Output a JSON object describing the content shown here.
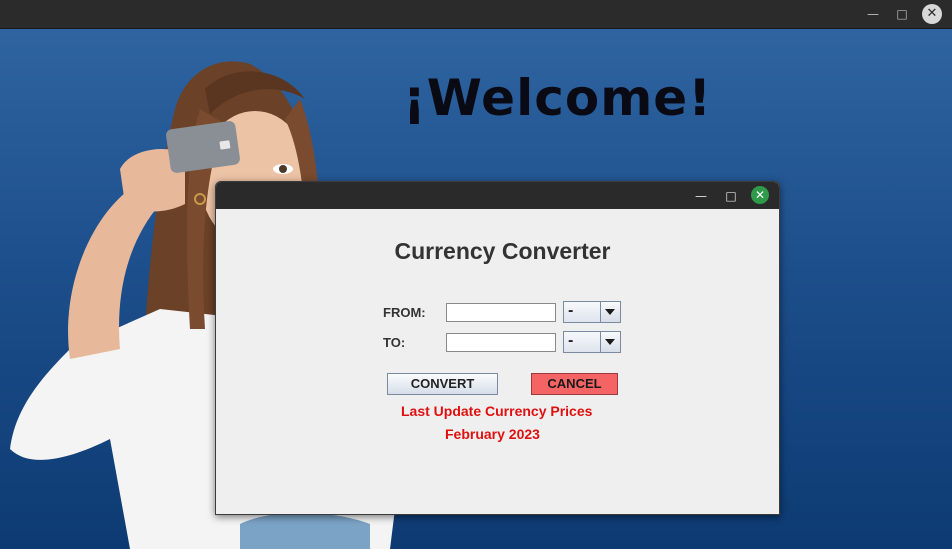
{
  "outer_window": {
    "minimize_icon": "minimize-icon",
    "maximize_icon": "maximize-icon",
    "close_icon": "close-icon",
    "background_color": "#1d4f8c"
  },
  "banner": {
    "welcome": "¡Welcome!"
  },
  "dialog": {
    "title": "Currency Converter",
    "close_color": "#2f9a4a",
    "form": {
      "from_label": "FROM:",
      "to_label": "TO:",
      "from_value": "",
      "to_value": "",
      "from_currency": "-",
      "to_currency": "-"
    },
    "buttons": {
      "convert": "CONVERT",
      "cancel": "CANCEL",
      "cancel_color": "#f56464"
    },
    "notes": {
      "line1": "Last Update Currency Prices",
      "line2": "February 2023",
      "color": "#e01010"
    }
  }
}
